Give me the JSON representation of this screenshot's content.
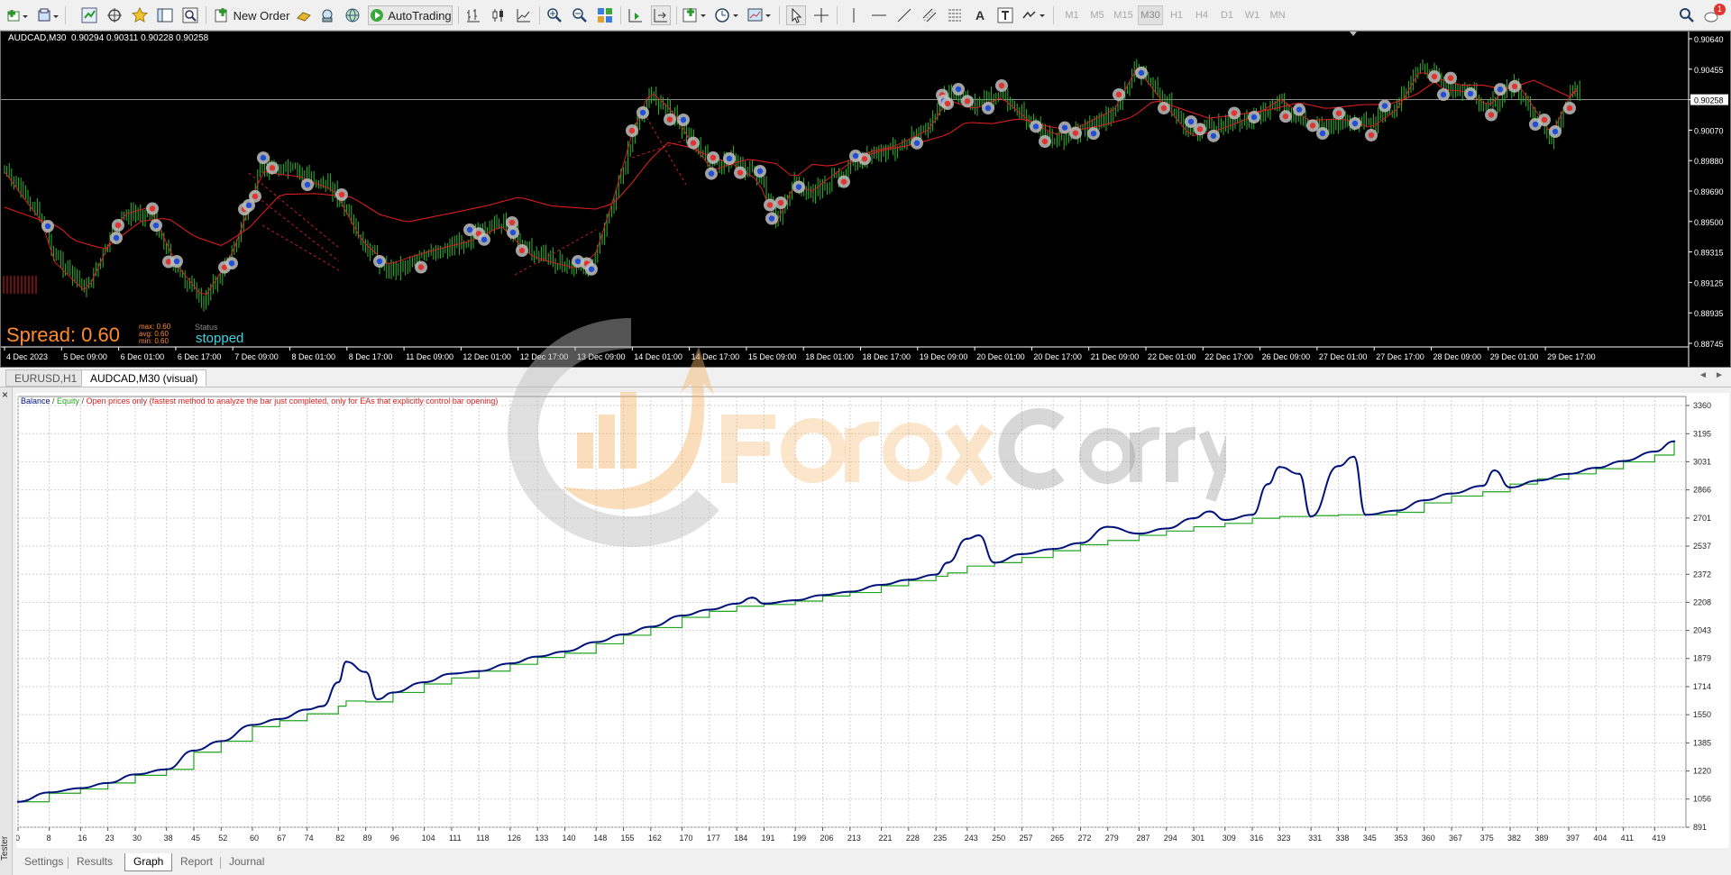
{
  "toolbar": {
    "new_order_label": "New Order",
    "autotrading_label": "AutoTrading",
    "timeframes": [
      "M1",
      "M5",
      "M15",
      "M30",
      "H1",
      "H4",
      "D1",
      "W1",
      "MN"
    ],
    "active_timeframe": "M30",
    "notification_count": "1"
  },
  "chart": {
    "symbol_info": "AUDCAD,M30  0.90294 0.90311 0.90228 0.90258",
    "current_price": "0.90258",
    "price_axis": [
      "0.90640",
      "0.90455",
      "0.90258",
      "0.90070",
      "0.89880",
      "0.89690",
      "0.89500",
      "0.89315",
      "0.89125",
      "0.88935",
      "0.88745"
    ],
    "time_axis": [
      "4 Dec 2023",
      "5 Dec 09:00",
      "6 Dec 01:00",
      "6 Dec 17:00",
      "7 Dec 09:00",
      "8 Dec 01:00",
      "8 Dec 17:00",
      "11 Dec 09:00",
      "12 Dec 01:00",
      "12 Dec 17:00",
      "13 Dec 09:00",
      "14 Dec 01:00",
      "14 Dec 17:00",
      "15 Dec 09:00",
      "18 Dec 01:00",
      "18 Dec 17:00",
      "19 Dec 09:00",
      "20 Dec 01:00",
      "20 Dec 17:00",
      "21 Dec 09:00",
      "22 Dec 01:00",
      "22 Dec 17:00",
      "26 Dec 09:00",
      "27 Dec 01:00",
      "27 Dec 17:00",
      "28 Dec 09:00",
      "29 Dec 01:00",
      "29 Dec 17:00"
    ],
    "spread_label": "Spread: 0.60",
    "spread_stats": {
      "max_label": "max:",
      "max": "0.60",
      "avg_label": "avg:",
      "avg": "0.60",
      "min_label": "min:",
      "min": "0.60"
    },
    "status_label": "Status",
    "status_value": "stopped",
    "colors": {
      "candle": "#2fb52f",
      "ma": "#d81e1e",
      "marker_buy": "#1f4fd8",
      "marker_sell": "#e0342e"
    }
  },
  "chart_tabs": [
    "EURUSD,H1",
    "AUDCAD,M30 (visual)"
  ],
  "active_chart_tab": 1,
  "tester": {
    "side_label": "Tester",
    "close_glyph": "×",
    "legend": {
      "balance": "Balance",
      "sep1": " / ",
      "equity": "Equity",
      "sep2": " / ",
      "mode": "Open prices only (fastest method to analyze the bar just completed, only for EAs that explicitly control bar opening)"
    },
    "tabs": [
      "Settings",
      "Results",
      "Graph",
      "Report",
      "Journal"
    ],
    "active_tab": "Graph"
  },
  "chart_data": {
    "type": "line",
    "title": "",
    "xlabel": "",
    "ylabel": "",
    "x_ticks": [
      0,
      8,
      16,
      23,
      30,
      38,
      45,
      52,
      60,
      67,
      74,
      82,
      89,
      96,
      104,
      111,
      118,
      126,
      133,
      140,
      148,
      155,
      162,
      170,
      177,
      184,
      191,
      199,
      206,
      213,
      221,
      228,
      235,
      243,
      250,
      257,
      265,
      272,
      279,
      287,
      294,
      301,
      309,
      316,
      323,
      331,
      338,
      345,
      353,
      360,
      367,
      375,
      382,
      389,
      397,
      404,
      411,
      419
    ],
    "y_ticks": [
      891,
      1056,
      1220,
      1385,
      1550,
      1714,
      1879,
      2043,
      2208,
      2372,
      2537,
      2701,
      2866,
      3031,
      3195,
      3360
    ],
    "xlim": [
      0,
      427
    ],
    "ylim": [
      891,
      3360
    ],
    "grid": true,
    "colors": {
      "balance": "#00137a",
      "equity": "#1fa51f",
      "legend_mode": "#d81e1e"
    },
    "series": [
      {
        "name": "Balance",
        "x": [
          0,
          8,
          16,
          23,
          30,
          38,
          45,
          52,
          60,
          67,
          74,
          82,
          84,
          89,
          96,
          104,
          111,
          118,
          126,
          133,
          140,
          148,
          155,
          162,
          170,
          177,
          184,
          191,
          199,
          206,
          213,
          221,
          228,
          235,
          238,
          243,
          250,
          257,
          265,
          272,
          279,
          287,
          294,
          301,
          309,
          316,
          323,
          331,
          338,
          345,
          353,
          360,
          367,
          375,
          382,
          389,
          397,
          404,
          411,
          419,
          424
        ],
        "y": [
          1040,
          1090,
          1115,
          1150,
          1195,
          1230,
          1330,
          1395,
          1480,
          1515,
          1555,
          1600,
          1630,
          1625,
          1680,
          1730,
          1765,
          1805,
          1845,
          1885,
          1910,
          1965,
          2015,
          2060,
          2120,
          2155,
          2185,
          2195,
          2215,
          2245,
          2265,
          2305,
          2335,
          2360,
          2380,
          2420,
          2440,
          2470,
          2510,
          2545,
          2570,
          2600,
          2625,
          2650,
          2670,
          2700,
          2710,
          2715,
          2720,
          2720,
          2735,
          2790,
          2830,
          2855,
          2900,
          2930,
          2960,
          2990,
          3030,
          3070,
          3150
        ]
      },
      {
        "name": "Equity",
        "x": [
          0,
          8,
          16,
          23,
          30,
          38,
          45,
          52,
          60,
          67,
          74,
          78,
          82,
          84,
          89,
          92,
          96,
          104,
          111,
          118,
          126,
          133,
          140,
          148,
          155,
          162,
          170,
          177,
          184,
          188,
          191,
          199,
          206,
          213,
          221,
          228,
          235,
          238,
          243,
          246,
          250,
          257,
          265,
          272,
          279,
          287,
          294,
          301,
          305,
          309,
          316,
          320,
          323,
          328,
          331,
          338,
          342,
          345,
          353,
          360,
          367,
          375,
          378,
          382,
          389,
          397,
          404,
          411,
          419,
          424
        ],
        "y": [
          1040,
          1095,
          1120,
          1150,
          1200,
          1230,
          1340,
          1395,
          1490,
          1525,
          1580,
          1600,
          1740,
          1860,
          1800,
          1640,
          1680,
          1740,
          1790,
          1805,
          1850,
          1890,
          1920,
          1975,
          2020,
          2065,
          2130,
          2165,
          2200,
          2235,
          2200,
          2220,
          2250,
          2270,
          2310,
          2340,
          2370,
          2440,
          2580,
          2600,
          2440,
          2490,
          2520,
          2555,
          2650,
          2610,
          2640,
          2700,
          2740,
          2690,
          2720,
          2900,
          3000,
          2960,
          2710,
          3005,
          3060,
          2720,
          2745,
          2805,
          2845,
          2890,
          2980,
          2880,
          2920,
          2960,
          2995,
          3035,
          3090,
          3150
        ]
      }
    ]
  }
}
